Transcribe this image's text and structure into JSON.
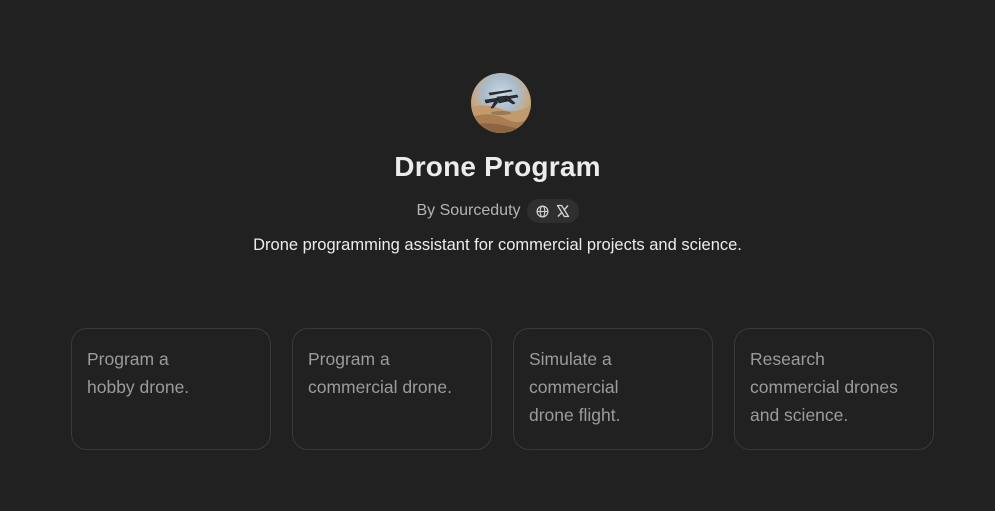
{
  "gpt": {
    "title": "Drone Program",
    "byline": "By Sourceduty",
    "description": "Drone programming assistant for commercial projects and science.",
    "links": [
      {
        "icon": "globe-icon"
      },
      {
        "icon": "x-logo-icon"
      }
    ]
  },
  "starters": [
    {
      "line1": "Program a",
      "line2": "hobby drone.",
      "line3": ""
    },
    {
      "line1": "Program a",
      "line2": "commercial drone.",
      "line3": ""
    },
    {
      "line1": "Simulate a",
      "line2": "commercial",
      "line3": "drone flight."
    },
    {
      "line1": "Research",
      "line2": "commercial drones",
      "line3": "and science."
    }
  ],
  "colors": {
    "background": "#212121",
    "card_border": "#3a3a3a",
    "primary_text": "#ececec",
    "muted_text": "#9b9b9b"
  }
}
